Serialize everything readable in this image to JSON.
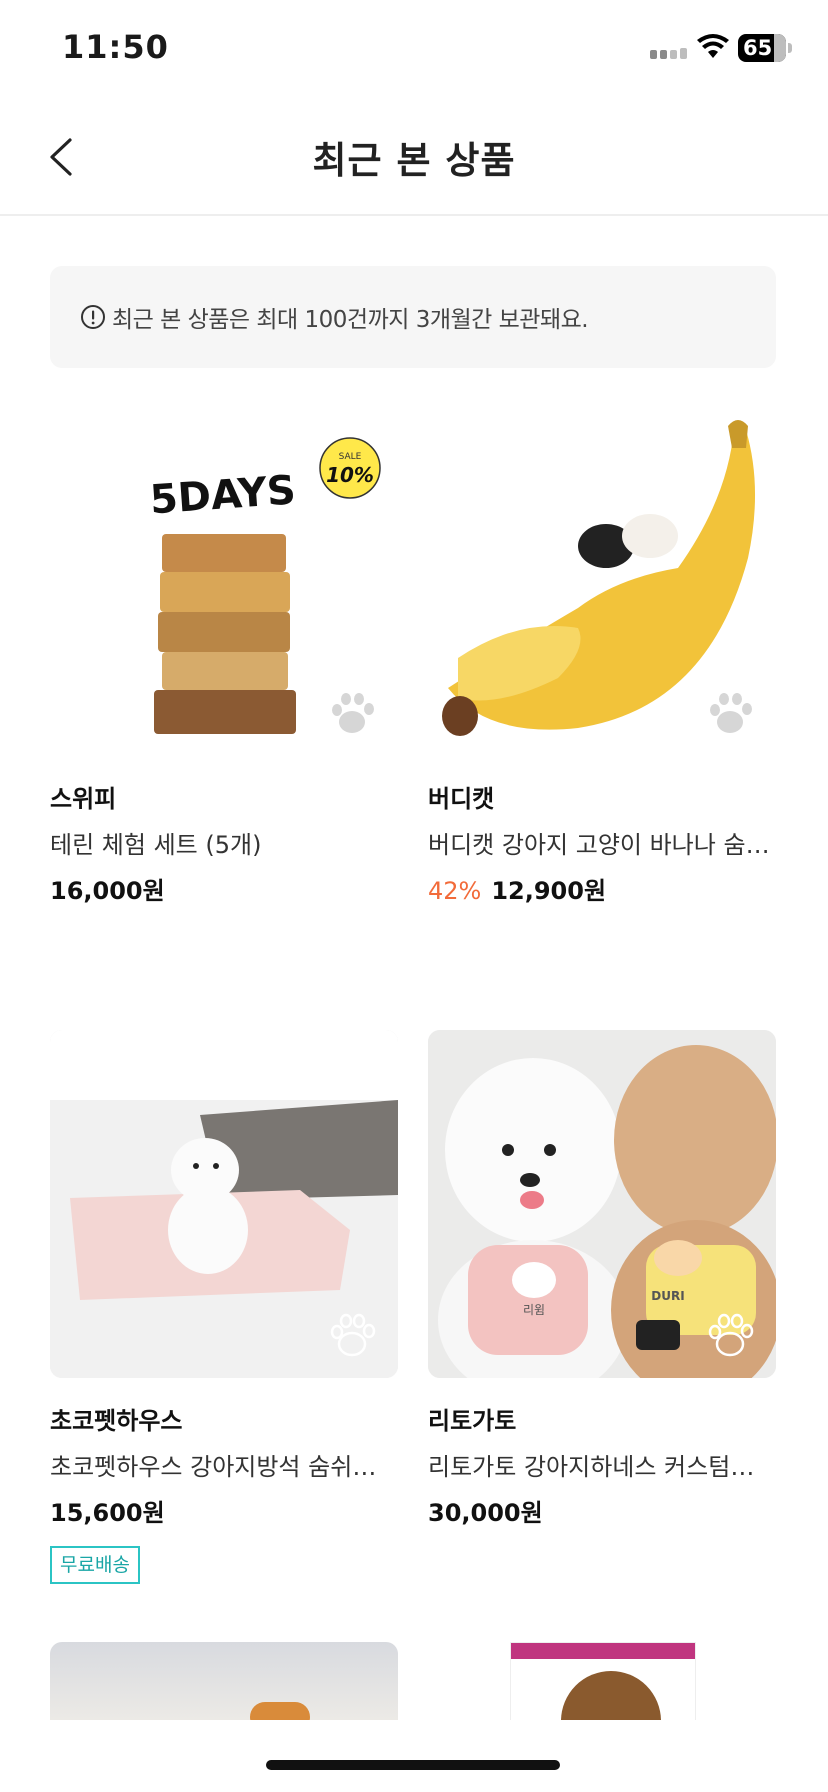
{
  "status_bar": {
    "time": "11:50",
    "battery": "65"
  },
  "header": {
    "title": "최근 본 상품"
  },
  "notice": {
    "text": "최근 본 상품은 최대 100건까지 3개월간 보관돼요."
  },
  "products": [
    {
      "brand": "스위피",
      "name": "테린 체험 세트 (5개)",
      "discount": "",
      "price": "16,000원",
      "badge": "",
      "image_text": "5DAYS",
      "sale_sticker_top": "SALE",
      "sale_sticker": "10%"
    },
    {
      "brand": "버디캣",
      "name": "버디캣 강아지 고양이 바나나 숨숨집",
      "discount": "42%",
      "price": "12,900원",
      "badge": ""
    },
    {
      "brand": "초코펫하우스",
      "name": "초코펫하우스 강아지방석 숨쉬는 매트",
      "discount": "",
      "price": "15,600원",
      "badge": "무료배송"
    },
    {
      "brand": "리토가토",
      "name": "리토가토 강아지하네스 커스텀하네스",
      "discount": "",
      "price": "30,000원",
      "badge": "",
      "image_text_left": "리윔",
      "image_text_right": "DURI"
    }
  ],
  "colors": {
    "discount": "#f26b3a",
    "badge": "#2bc4c4",
    "notice_bg": "#f6f6f6"
  }
}
